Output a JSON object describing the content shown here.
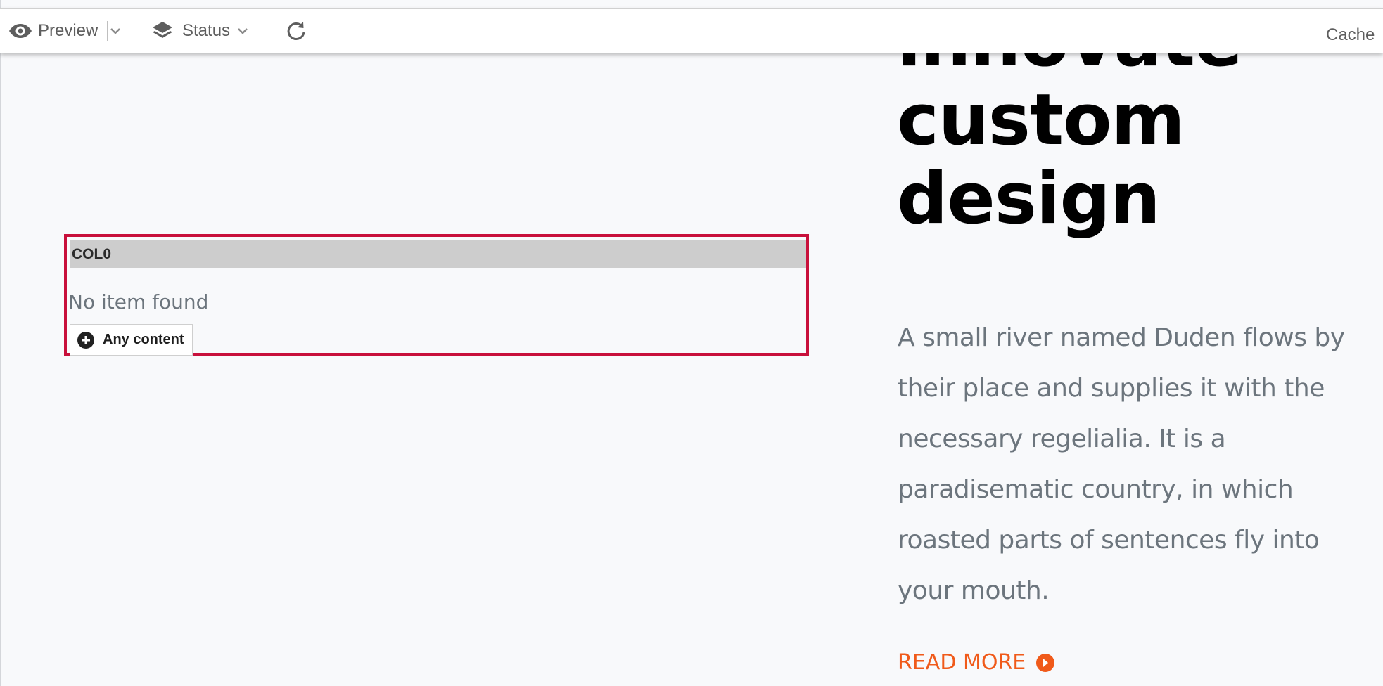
{
  "toolbar": {
    "preview_label": "Preview",
    "status_label": "Status",
    "cache_label": "Cache"
  },
  "grid": {
    "column_header": "COL0",
    "empty_text": "No item found",
    "add_button_label": "Any content"
  },
  "hero": {
    "title_lines": [
      "innovate",
      "custom",
      "design"
    ],
    "body": "A small river named Duden flows by their place and supplies it with the necessary regelialia. It is a paradisematic country, in which roasted parts of sentences fly into your mouth.",
    "read_more_label": "READ MORE"
  },
  "colors": {
    "accent_orange": "#f05a1a",
    "grid_border_red": "#c8103b",
    "header_gray": "#cdcdcd"
  },
  "icons": {
    "preview": "eye-icon",
    "preview_dropdown": "chevron-down-icon",
    "status": "layers-icon",
    "status_dropdown": "chevron-down-icon",
    "reload": "reload-icon",
    "add_content": "plus-circle-icon",
    "read_more": "arrow-circle-right-icon"
  }
}
